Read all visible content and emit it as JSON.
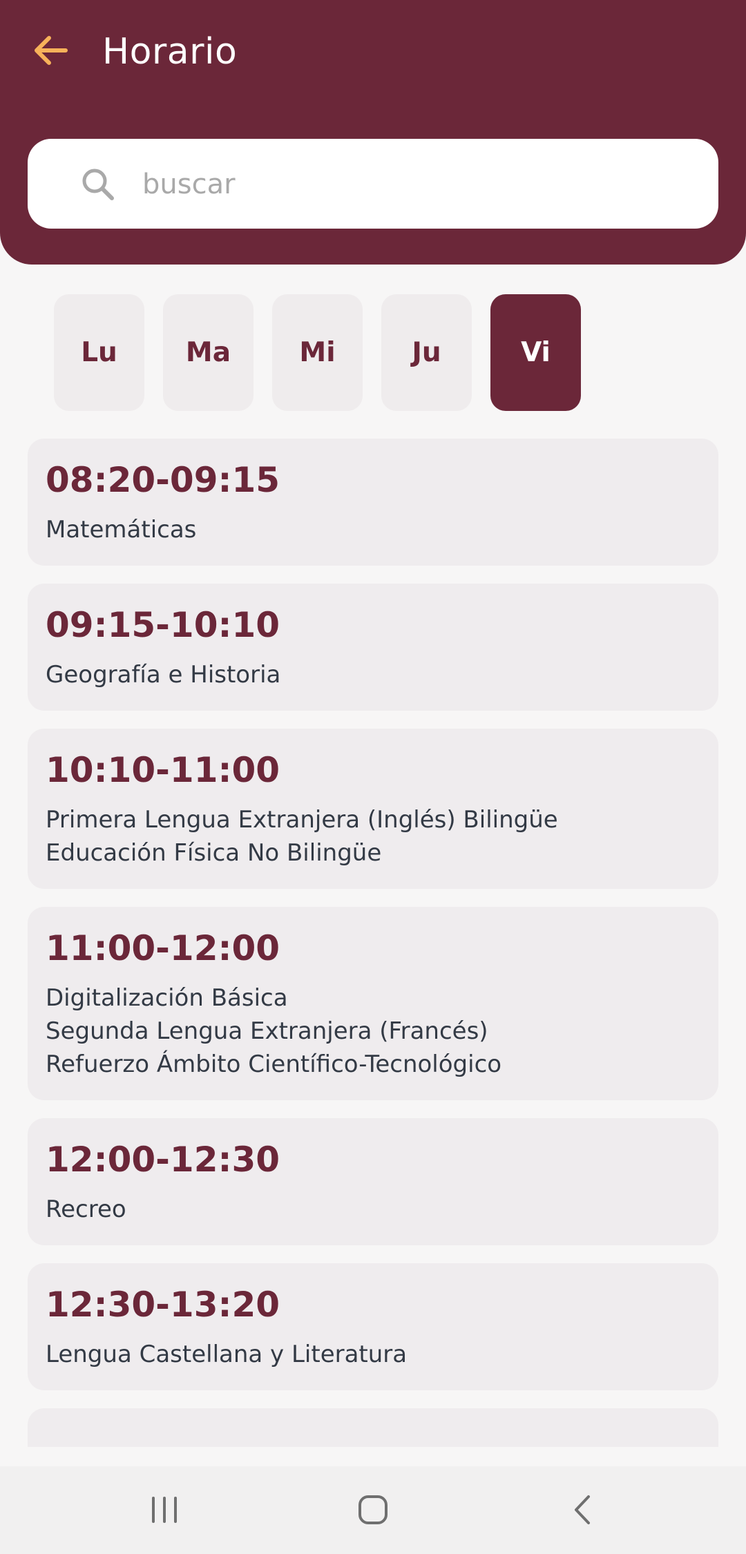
{
  "header": {
    "title": "Horario",
    "back_icon": "arrow-left-icon",
    "accent": "#f7b25a",
    "brand": "#6b2739"
  },
  "search": {
    "placeholder": "buscar",
    "value": "",
    "icon": "search-icon"
  },
  "days": {
    "items": [
      {
        "label": "Lu",
        "selected": false
      },
      {
        "label": "Ma",
        "selected": false
      },
      {
        "label": "Mi",
        "selected": false
      },
      {
        "label": "Ju",
        "selected": false
      },
      {
        "label": "Vi",
        "selected": true
      }
    ]
  },
  "schedule": [
    {
      "time": "08:20-09:15",
      "subjects": [
        "Matemáticas"
      ]
    },
    {
      "time": "09:15-10:10",
      "subjects": [
        "Geografía e Historia"
      ]
    },
    {
      "time": "10:10-11:00",
      "subjects": [
        "Primera Lengua Extranjera (Inglés) Bilingüe",
        "Educación Física No Bilingüe"
      ]
    },
    {
      "time": "11:00-12:00",
      "subjects": [
        "Digitalización Básica",
        "Segunda Lengua Extranjera (Francés)",
        "Refuerzo Ámbito Científico-Tecnológico"
      ]
    },
    {
      "time": "12:00-12:30",
      "subjects": [
        "Recreo"
      ]
    },
    {
      "time": "12:30-13:20",
      "subjects": [
        "Lengua Castellana y Literatura"
      ]
    }
  ],
  "navbar": {
    "recents_icon": "recent-apps-icon",
    "home_icon": "home-icon",
    "back_icon": "back-chevron-icon"
  }
}
